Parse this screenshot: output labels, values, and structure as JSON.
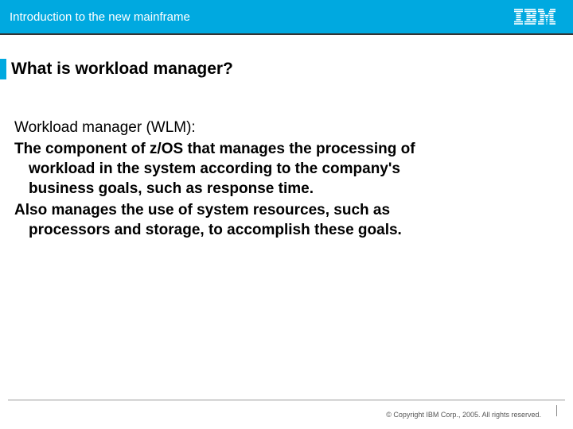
{
  "header": {
    "subtitle": "Introduction to the new mainframe",
    "logo_label": "IBM"
  },
  "slide": {
    "title": "What is workload manager?",
    "lead": "Workload manager (WLM):",
    "para1_line1": "The component of z/OS that manages the processing of",
    "para1_line2": "workload in the system according to the company's",
    "para1_line3": "business goals, such as response time.",
    "para2_line1": "Also manages the use of system resources, such as",
    "para2_line2": "processors and storage, to accomplish these goals."
  },
  "footer": {
    "copyright": "© Copyright IBM Corp., 2005. All rights reserved."
  }
}
